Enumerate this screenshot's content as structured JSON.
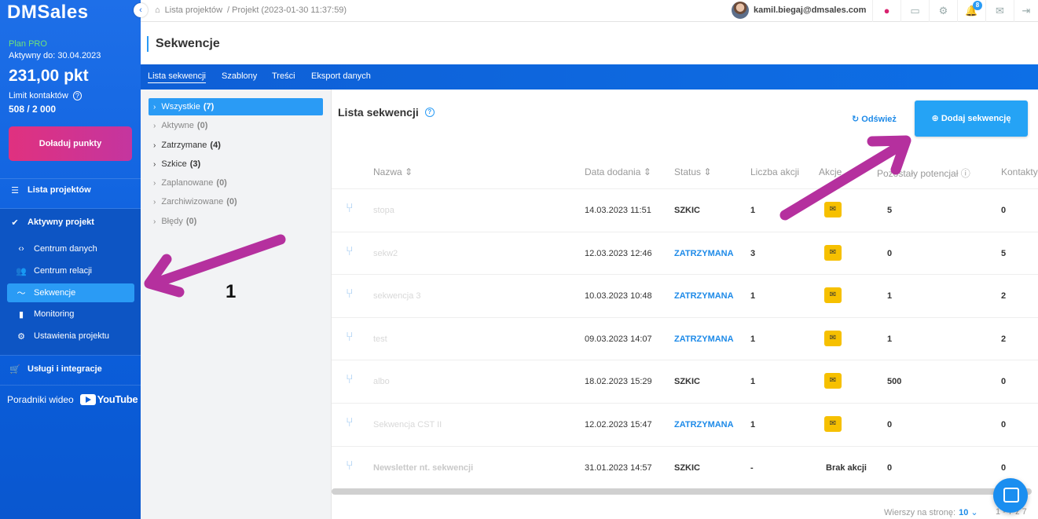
{
  "sidebar": {
    "logo": "DMSales",
    "collapse_icon": "‹",
    "plan": "Plan PRO",
    "active_to": "Aktywny do: 30.04.2023",
    "points": "231,00 pkt",
    "limit_label": "Limit kontaktów",
    "limit_value": "508 / 2 000",
    "topup_label": "Doładuj punkty",
    "project_list": "Lista projektów",
    "active_project": "Aktywny projekt",
    "items": [
      "Centrum danych",
      "Centrum relacji",
      "Sekwencje",
      "Monitoring",
      "Ustawienia projektu"
    ],
    "services": "Usługi i integracje",
    "video_label": "Poradniki wideo",
    "youtube": "YouTube"
  },
  "topbar": {
    "crumb1": "Lista projektów",
    "crumb2": "/  Projekt (2023-01-30 11:37:59)",
    "user": "kamil.biegaj@dmsales.com",
    "notif_count": "8"
  },
  "page": {
    "title": "Sekwencje",
    "tabs": [
      "Lista sekwencji",
      "Szablony",
      "Treści",
      "Eksport danych"
    ]
  },
  "filters": [
    {
      "label": "Wszystkie",
      "count": "(7)"
    },
    {
      "label": "Aktywne",
      "count": "(0)"
    },
    {
      "label": "Zatrzymane",
      "count": "(4)"
    },
    {
      "label": "Szkice",
      "count": "(3)"
    },
    {
      "label": "Zaplanowane",
      "count": "(0)"
    },
    {
      "label": "Zarchiwizowane",
      "count": "(0)"
    },
    {
      "label": "Błędy",
      "count": "(0)"
    }
  ],
  "list": {
    "title": "Lista sekwencji",
    "refresh": "Odśwież",
    "add": "Dodaj sekwencję",
    "columns": [
      "Nazwa",
      "Data dodania",
      "Status",
      "Liczba akcji",
      "Akcje",
      "Pozostały potencjał",
      "Kontakty"
    ],
    "rows": [
      {
        "name": "stopa",
        "date": "14.03.2023 11:51",
        "status": "SZKIC",
        "actions_count": "1",
        "potential": "5",
        "contacts": "0"
      },
      {
        "name": "sekw2",
        "date": "12.03.2023 12:46",
        "status": "ZATRZYMANA",
        "actions_count": "3",
        "potential": "0",
        "contacts": "5"
      },
      {
        "name": "sekwencja 3",
        "date": "10.03.2023 10:48",
        "status": "ZATRZYMANA",
        "actions_count": "1",
        "potential": "1",
        "contacts": "2"
      },
      {
        "name": "test",
        "date": "09.03.2023 14:07",
        "status": "ZATRZYMANA",
        "actions_count": "1",
        "potential": "1",
        "contacts": "2"
      },
      {
        "name": "albo",
        "date": "18.02.2023 15:29",
        "status": "SZKIC",
        "actions_count": "1",
        "potential": "500",
        "contacts": "0"
      },
      {
        "name": "Sekwencja CST II",
        "date": "12.02.2023 15:47",
        "status": "ZATRZYMANA",
        "actions_count": "1",
        "potential": "0",
        "contacts": "0"
      },
      {
        "name": "Newsletter nt. sekwencji",
        "date": "31.01.2023 14:57",
        "status": "SZKIC",
        "actions_count": "-",
        "no_actions": "Brak akcji",
        "potential": "0",
        "contacts": "0"
      }
    ],
    "rows_per_page_label": "Wierszy na stronę:",
    "rows_per_page": "10",
    "pager": "1 - 7 z 7"
  },
  "annotation": {
    "number": "1",
    "arrow_color": "#b5309e"
  }
}
